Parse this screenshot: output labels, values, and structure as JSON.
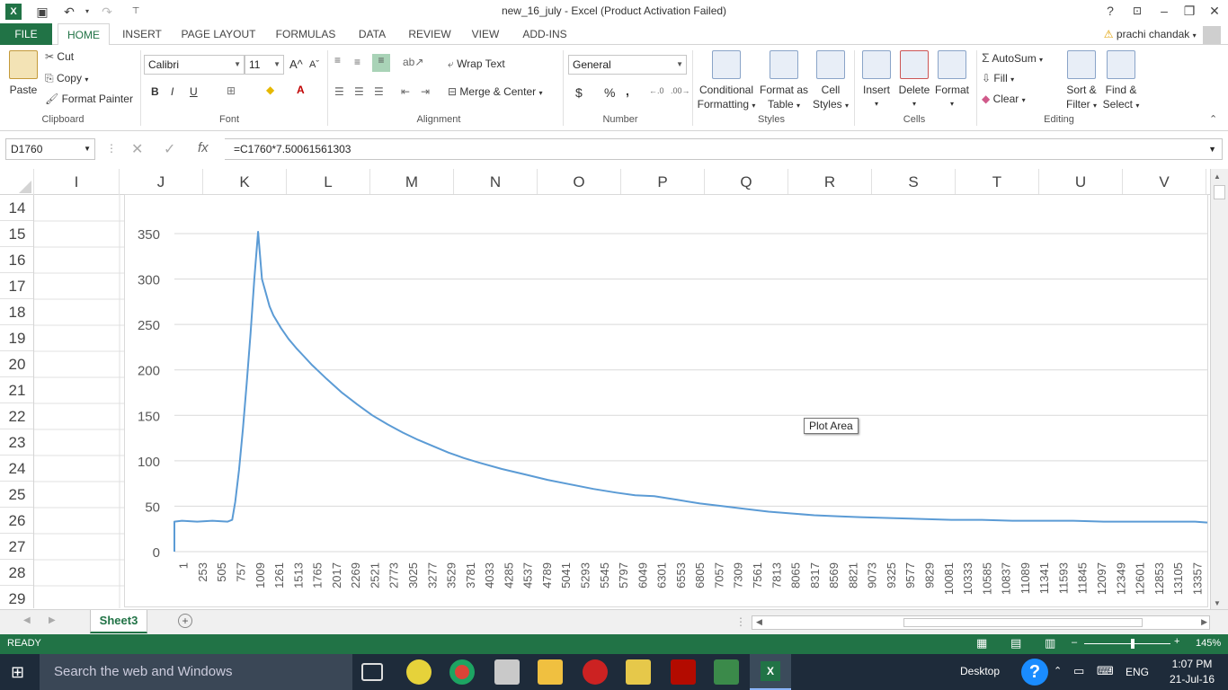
{
  "window": {
    "title": "new_16_july - Excel (Product Activation Failed)",
    "help": "?",
    "minimize": "–",
    "restore": "❐",
    "close": "✕"
  },
  "quick_access": {
    "save": "💾",
    "undo": "↶",
    "redo": "↷",
    "more": "▾"
  },
  "tabs": [
    "FILE",
    "HOME",
    "INSERT",
    "PAGE LAYOUT",
    "FORMULAS",
    "DATA",
    "REVIEW",
    "VIEW",
    "ADD-INS"
  ],
  "user": {
    "name": "prachi chandak"
  },
  "ribbon": {
    "clipboard": {
      "paste": "Paste",
      "cut": "Cut",
      "copy": "Copy",
      "format_painter": "Format Painter",
      "label": "Clipboard"
    },
    "font": {
      "name": "Calibri",
      "size": "11",
      "label": "Font",
      "bold": "B",
      "italic": "I",
      "underline": "U",
      "grow": "A",
      "shrink": "A"
    },
    "alignment": {
      "wrap_text": "Wrap Text",
      "merge_center": "Merge & Center",
      "label": "Alignment"
    },
    "number": {
      "format": "General",
      "currency": "$",
      "percent": "%",
      "comma": ",",
      "label": "Number"
    },
    "styles": {
      "conditional": "Conditional",
      "formatting": "Formatting",
      "format_as": "Format as",
      "table": "Table",
      "cell": "Cell",
      "styles_word": "Styles",
      "label": "Styles"
    },
    "cells": {
      "insert": "Insert",
      "delete": "Delete",
      "format": "Format",
      "label": "Cells"
    },
    "editing": {
      "autosum": "AutoSum",
      "fill": "Fill",
      "clear": "Clear",
      "sort": "Sort &",
      "filter": "Filter",
      "find": "Find &",
      "select": "Select",
      "label": "Editing"
    }
  },
  "formula_bar": {
    "name_box": "D1760",
    "fx": "fx",
    "formula": "=C1760*7.50061561303"
  },
  "columns": [
    "I",
    "J",
    "K",
    "L",
    "M",
    "N",
    "O",
    "P",
    "Q",
    "R",
    "S",
    "T",
    "U",
    "V"
  ],
  "rows": [
    "14",
    "15",
    "16",
    "17",
    "18",
    "19",
    "20",
    "21",
    "22",
    "23",
    "24",
    "25",
    "26",
    "27",
    "28",
    "29"
  ],
  "chart_tooltip": "Plot Area",
  "chart_data": {
    "type": "line",
    "title": "",
    "xlabel": "",
    "ylabel": "",
    "ylim": [
      0,
      350
    ],
    "yticks": [
      0,
      50,
      100,
      150,
      200,
      250,
      300,
      350
    ],
    "x_tick_labels": [
      "1",
      "253",
      "505",
      "757",
      "1009",
      "1261",
      "1513",
      "1765",
      "2017",
      "2269",
      "2521",
      "2773",
      "3025",
      "3277",
      "3529",
      "3781",
      "4033",
      "4285",
      "4537",
      "4789",
      "5041",
      "5293",
      "5545",
      "5797",
      "6049",
      "6301",
      "6553",
      "6805",
      "7057",
      "7309",
      "7561",
      "7813",
      "8065",
      "8317",
      "8569",
      "8821",
      "9073",
      "9325",
      "9577",
      "9829",
      "10081",
      "10333",
      "10585",
      "10837",
      "11089",
      "11341",
      "11593",
      "11845",
      "12097",
      "12349",
      "12601",
      "12853",
      "13105",
      "13357"
    ],
    "xlim": [
      1,
      13560
    ],
    "grid": true,
    "legend": "none",
    "series": [
      {
        "color": "#5b9bd5",
        "x": [
          1,
          100,
          300,
          500,
          700,
          760,
          800,
          850,
          900,
          950,
          1000,
          1050,
          1100,
          1150,
          1200,
          1250,
          1300,
          1400,
          1500,
          1600,
          1700,
          1800,
          1900,
          2000,
          2200,
          2400,
          2600,
          2800,
          3000,
          3200,
          3400,
          3600,
          3800,
          4000,
          4300,
          4600,
          4900,
          5200,
          5500,
          5800,
          6049,
          6300,
          6600,
          6900,
          7200,
          7500,
          7800,
          8100,
          8400,
          8700,
          9000,
          9400,
          9800,
          10200,
          10600,
          11000,
          11400,
          11800,
          12200,
          12600,
          13000,
          13400,
          13560
        ],
        "y": [
          33,
          34,
          33,
          34,
          33,
          35,
          55,
          90,
          135,
          185,
          240,
          300,
          352,
          300,
          285,
          270,
          260,
          246,
          234,
          224,
          215,
          206,
          198,
          190,
          175,
          162,
          150,
          140,
          131,
          123,
          116,
          109,
          103,
          98,
          91,
          85,
          79,
          74,
          69,
          65,
          62,
          61,
          57,
          53,
          50,
          47,
          44,
          42,
          40,
          39,
          38,
          37,
          36,
          35,
          35,
          34,
          34,
          34,
          33,
          33,
          33,
          33,
          32
        ]
      }
    ]
  },
  "sheet_tab": "Sheet3",
  "status": {
    "ready": "READY",
    "zoom": "145%"
  },
  "taskbar": {
    "search": "Search the web and Windows",
    "desktop": "Desktop",
    "lang": "ENG",
    "time": "1:07 PM",
    "date": "21-Jul-16"
  }
}
